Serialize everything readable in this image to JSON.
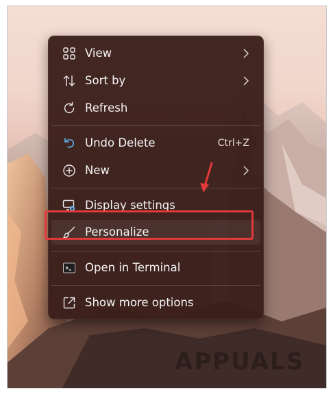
{
  "menu": {
    "items": [
      {
        "label": "View",
        "icon": "grid-icon",
        "submenu": true
      },
      {
        "label": "Sort by",
        "icon": "sort-arrows-icon",
        "submenu": true
      },
      {
        "label": "Refresh",
        "icon": "refresh-icon",
        "submenu": false
      },
      {
        "label": "Undo Delete",
        "icon": "undo-icon",
        "shortcut": "Ctrl+Z"
      },
      {
        "label": "New",
        "icon": "plus-circle-icon",
        "submenu": true
      },
      {
        "label": "Display settings",
        "icon": "display-settings-icon"
      },
      {
        "label": "Personalize",
        "icon": "brush-icon",
        "highlighted": true
      },
      {
        "label": "Open in Terminal",
        "icon": "terminal-icon"
      },
      {
        "label": "Show more options",
        "icon": "share-out-icon"
      }
    ]
  },
  "watermark": {
    "text": "APPUALS"
  },
  "colors": {
    "menu_bg": "#3a1e1a",
    "highlight": "#e03a3a",
    "accent_icon": "#5fb4e8"
  }
}
